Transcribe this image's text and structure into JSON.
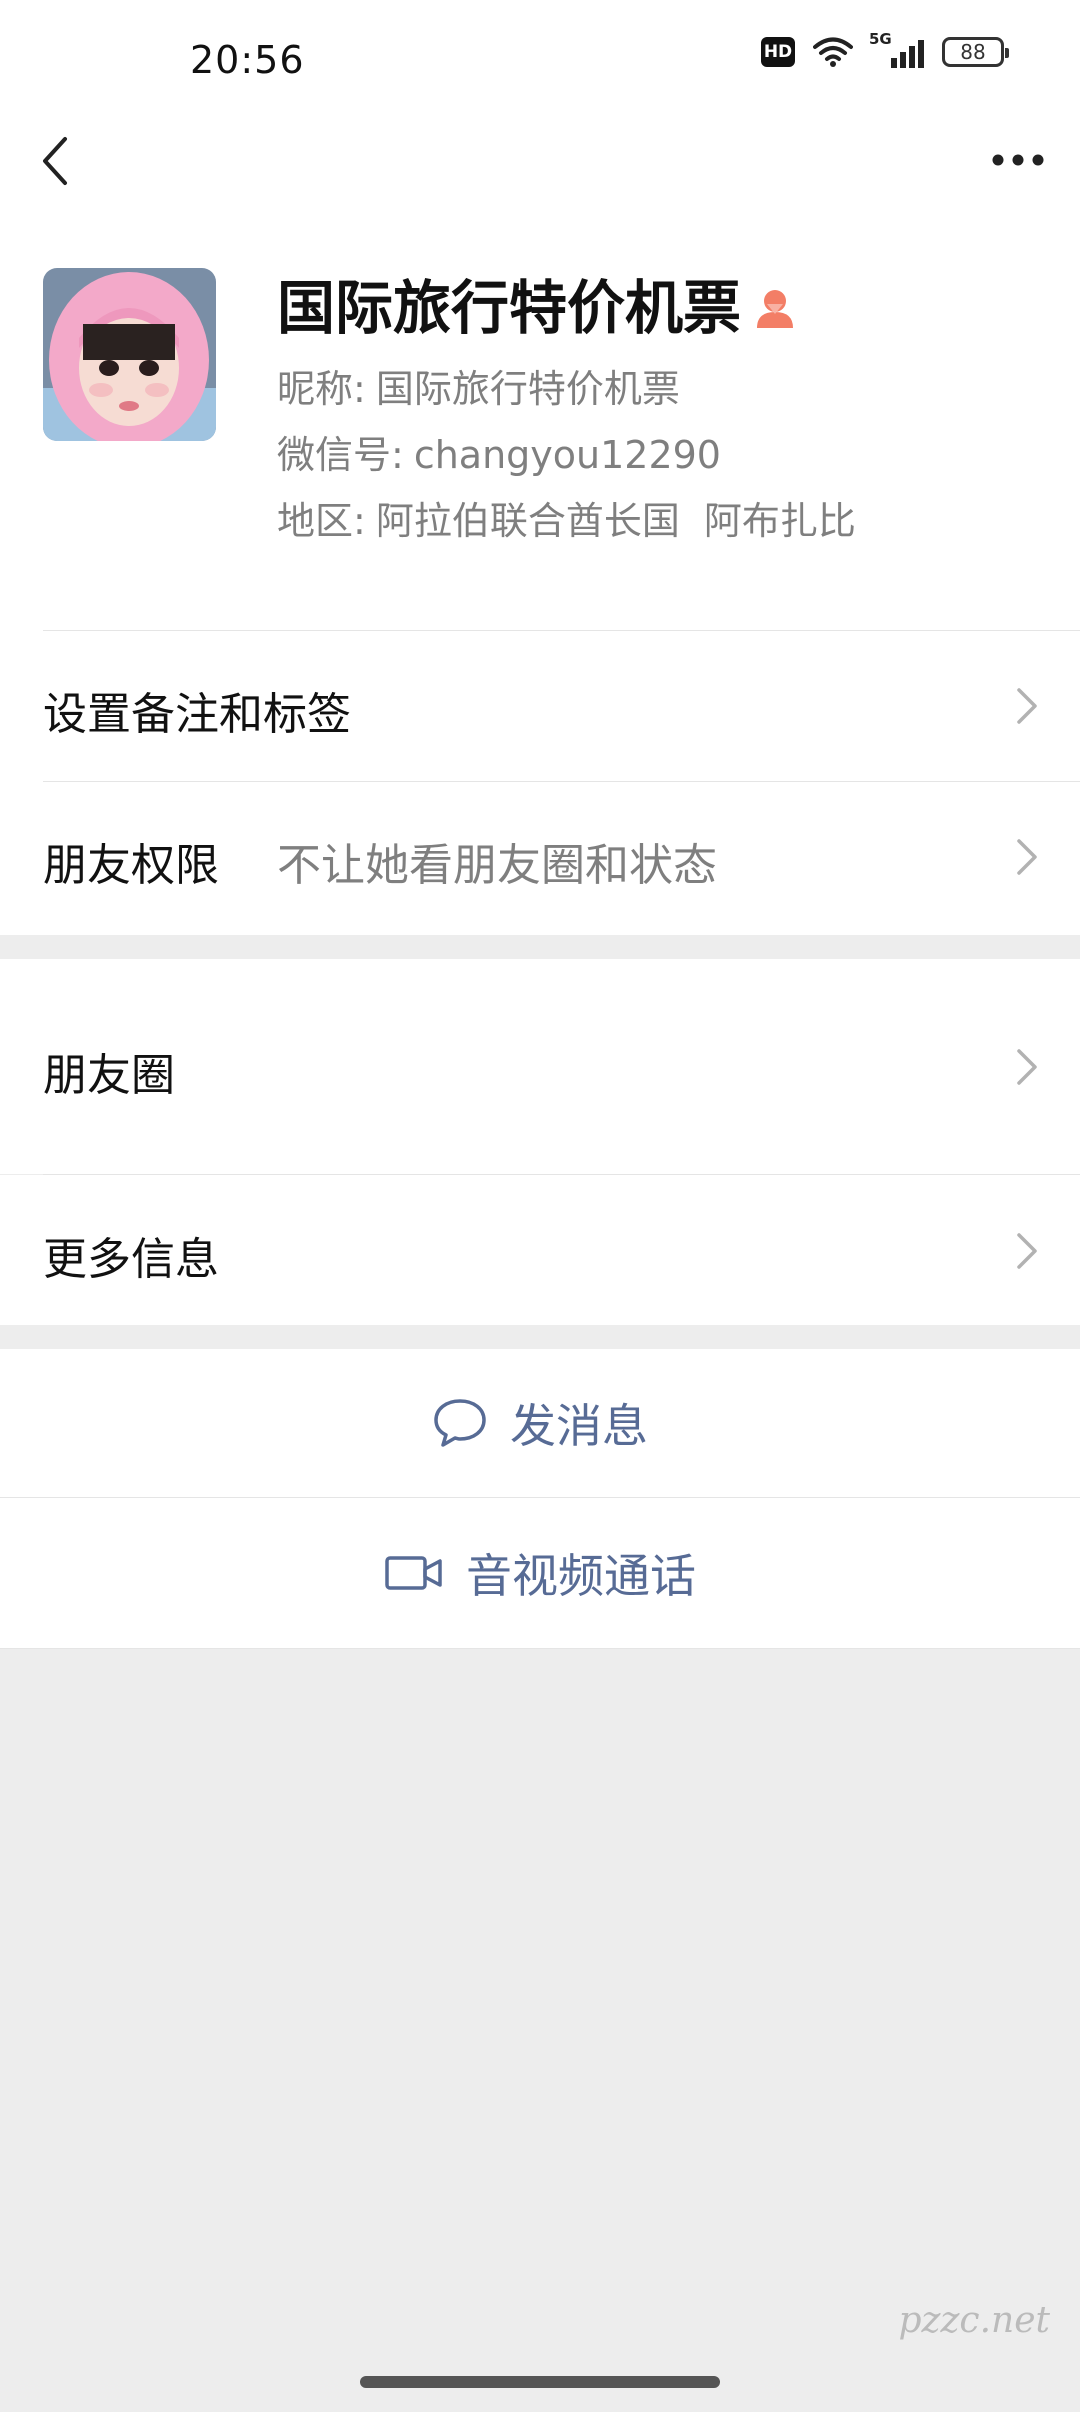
{
  "status_bar": {
    "time": "20:56",
    "hd_label": "HD",
    "network_label": "5G",
    "battery": "88"
  },
  "nav": {
    "back_icon": "chevron-left-icon",
    "more_icon": "more-horizontal-icon"
  },
  "profile": {
    "name": "国际旅行特价机票",
    "gender_icon": "female-icon",
    "gender_color": "#f37e66",
    "nickname_label": "昵称:",
    "nickname": "国际旅行特价机票",
    "wechat_label": "微信号:",
    "wechat_id": "changyou12290",
    "region_label": "地区:",
    "region_country": "阿拉伯联合酋长国",
    "region_city": "阿布扎比"
  },
  "rows": {
    "remark_label": "设置备注和标签",
    "permission_label": "朋友权限",
    "permission_value": "不让她看朋友圈和状态",
    "moments_label": "朋友圈",
    "more_info_label": "更多信息"
  },
  "actions": {
    "message_label": "发消息",
    "call_label": "音视频通话",
    "accent_color": "#576b95"
  },
  "watermark": "pzzc.net"
}
